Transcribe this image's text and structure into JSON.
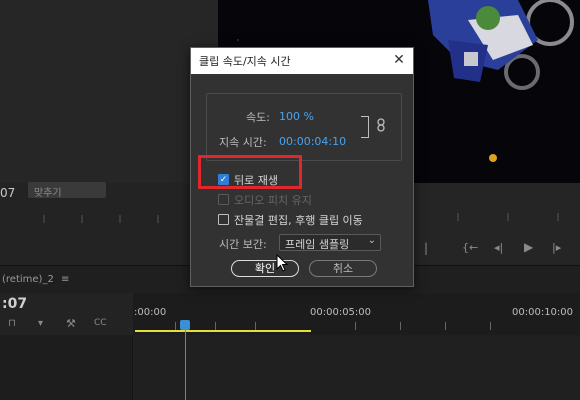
{
  "source_monitor": {
    "timecode_fragment": "07",
    "fit_label": "맞추기"
  },
  "timeline": {
    "sequence_name": "(retime)_2",
    "menu_icon": "≡",
    "timecode_fragment": ":07",
    "ruler_marks": [
      ":00:00",
      "00:00:05:00",
      "00:00:10:00"
    ]
  },
  "dialog": {
    "title": "클립 속도/지속 시간",
    "close_glyph": "✕",
    "speed_label": "속도:",
    "speed_value": "100 %",
    "duration_label": "지속 시간:",
    "duration_value": "00:00:04:10",
    "reverse_label": "뒤로 재생",
    "reverse_checked": true,
    "maintain_pitch_label": "오디오 피치 유지",
    "maintain_pitch_checked": false,
    "ripple_label": "잔물결 편집, 후행 클립 이동",
    "ripple_checked": false,
    "interp_label": "시간 보간:",
    "interp_value": "프레임 샘플링",
    "ok_label": "확인",
    "cancel_label": "취소"
  },
  "icons": {
    "link": "chain-link-icon",
    "close": "close-icon",
    "chevron": "chevron-down-icon"
  },
  "colors": {
    "accent": "#4aa3f0",
    "checkbox": "#2f7fd6",
    "highlight": "#e0272c",
    "work_area": "#e3de3a",
    "playhead": "#3a8fd8"
  }
}
